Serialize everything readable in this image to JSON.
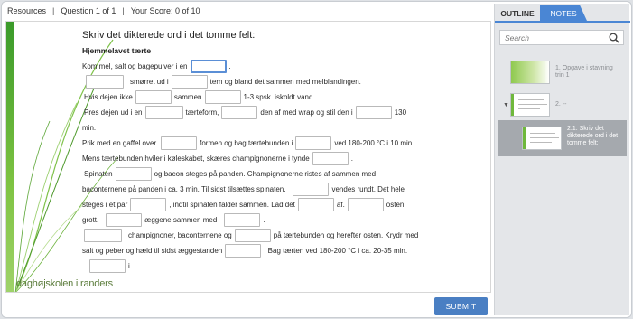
{
  "topbar": {
    "resources": "Resources",
    "question": "Question 1 of 1",
    "score": "Your Score: 0 of 10"
  },
  "slide": {
    "title": "Skriv det dikterede ord i det tomme felt:",
    "subtitle": "Hjemmelavet tærte",
    "logo": "daghøjskolen i randers",
    "lines": {
      "l1a": "Kom mel, salt og bagepulver i en",
      "l1b": ".",
      "l2a": "smørret ud i",
      "l2b": "tern og bland det sammen med melblandingen.",
      "l3a": "Hvis dejen ikke",
      "l3b": "sammen",
      "l3c": "1-3 spsk. iskoldt vand.",
      "l4a": "Pres dejen ud i en",
      "l4b": "tærteform,",
      "l4c": "den af med wrap og stil den i",
      "l4d": "130",
      "l5a": "min.",
      "l6a": "Prik med en gaffel over",
      "l6b": "formen og bag tærtebunden i",
      "l6c": "ved 180-200 °C i 10 min.",
      "l7a": "Mens tærtebunden hviler i køleskabet, skæres champignonerne i tynde",
      "l7b": ".",
      "l8a": "Spinaten",
      "l8b": "og bacon steges på panden. Champignonerne ristes af sammen med",
      "l9a": "baconternene på panden i ca. 3 min.  Til sidst tilsættes spinaten,",
      "l9b": "vendes rundt. Det hele",
      "l10a": "steges i et par",
      "l10b": ", indtil  spinaten falder sammen. Lad det",
      "l10c": "af.",
      "l10d": "osten",
      "l11a": "grott.",
      "l11b": "æggene sammen med",
      "l11c": ".",
      "l12a": "champignoner, baconternene og",
      "l12b": "på tærtebunden og herefter osten. Krydr med",
      "l13a": "salt og peber og hæld til sidst æggestanden",
      "l13b": ".  Bag tærten ved 180-200 °C i ca. 20-35 min.",
      "l14a": "i"
    }
  },
  "submit_label": "SUBMIT",
  "sidebar": {
    "tab_outline": "OUTLINE",
    "tab_notes": "NOTES",
    "search_placeholder": "Search",
    "items": [
      {
        "label": "1. Opgave i stavning trin 1"
      },
      {
        "label": "2. --"
      },
      {
        "label": "2.1. Skriv det dikterede ord i det tomme felt:"
      }
    ]
  },
  "colors": {
    "accent": "#4a86d4",
    "submit": "#4a7fc3",
    "brand_green": "#6fb83c",
    "selected_item": "#a5a9ae"
  }
}
